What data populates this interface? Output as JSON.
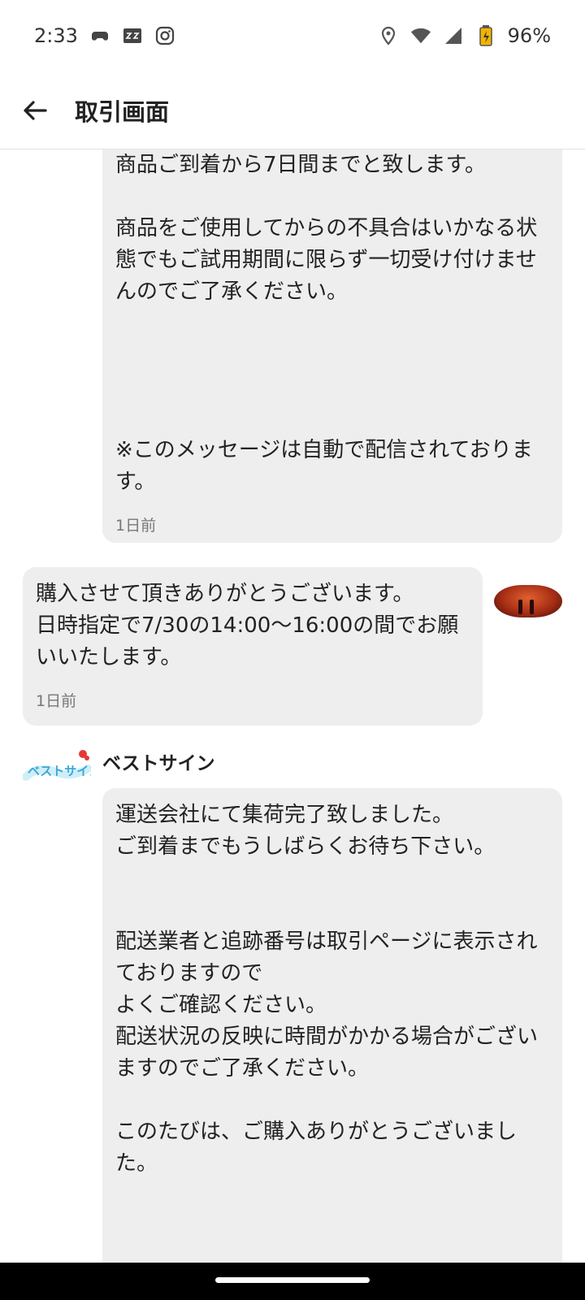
{
  "status_bar": {
    "time": "2:33",
    "battery": "96%"
  },
  "app_bar": {
    "title": "取引画面"
  },
  "messages": [
    {
      "text": "商品ご到着から7日間までと致します。\n\n商品をご使用してからの不具合はいかなる状態でもご試用期間に限らず一切受け付けませんのでご了承ください。\n\n\n\n\n※このメッセージは自動で配信されております。",
      "time": "1日前"
    },
    {
      "text": "購入させて頂きありがとうございます。\n日時指定で7/30の14:00〜16:00の間でお願いいたします。",
      "time": "1日前"
    },
    {
      "sender": "ベストサイン",
      "avatar_text": "ベストサイン",
      "text": "運送会社にて集荷完了致しました。\nご到着までもうしばらくお待ち下さい。\n\n\n配送業者と追跡番号は取引ページに表示されておりますので\nよくご確認ください。\n配送状況の反映に時間がかかる場合がございますのでご了承ください。\n\nこのたびは、ご購入ありがとうございました。"
    }
  ]
}
